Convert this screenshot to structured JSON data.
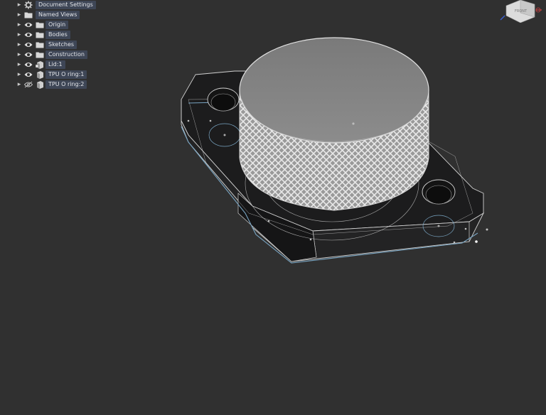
{
  "browser": {
    "items": [
      {
        "label": "Document Settings",
        "icon": "gear-icon",
        "eye": "none"
      },
      {
        "label": "Named Views",
        "icon": "folder-icon",
        "eye": "none"
      },
      {
        "label": "Origin",
        "icon": "folder-icon",
        "eye": "visible"
      },
      {
        "label": "Bodies",
        "icon": "folder-icon",
        "eye": "visible"
      },
      {
        "label": "Sketches",
        "icon": "folder-icon",
        "eye": "visible"
      },
      {
        "label": "Construction",
        "icon": "folder-icon",
        "eye": "visible"
      },
      {
        "label": "Lid:1",
        "icon": "component-icon",
        "eye": "visible"
      },
      {
        "label": "TPU O ring:1",
        "icon": "component-icon",
        "eye": "visible"
      },
      {
        "label": "TPU O ring:2",
        "icon": "component-icon",
        "eye": "hidden"
      }
    ]
  },
  "viewcube": {
    "face_label": "FRONT"
  },
  "colors": {
    "background": "#303030",
    "label_bg": "#3e4656",
    "edge": "#d0d0d0",
    "sketch_line": "#7aa6c4"
  }
}
